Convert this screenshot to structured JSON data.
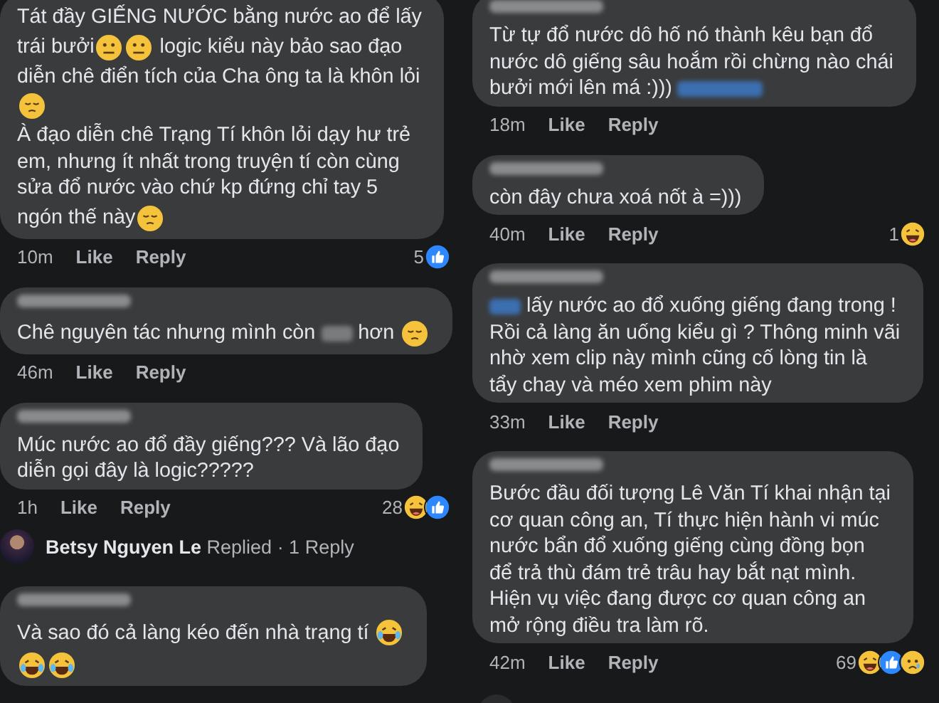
{
  "columns": [
    {
      "items": [
        {
          "kind": "comment",
          "name_visible": false,
          "lines": [
            [
              {
                "kind": "text",
                "text": "Tát đầy GIẾNG NƯỚC bằng nước ao để lấy"
              }
            ],
            [
              {
                "kind": "text",
                "text": "trái bưởi"
              },
              {
                "kind": "emoji-neutral"
              },
              {
                "kind": "emoji-neutral"
              },
              {
                "kind": "text",
                "text": " logic kiểu này bảo sao đạo"
              }
            ],
            [
              {
                "kind": "text",
                "text": "diễn chê điển tích của Cha ông ta là khôn lỏi"
              }
            ],
            [
              {
                "kind": "emoji-pensive"
              }
            ],
            [
              {
                "kind": "text",
                "text": "À đạo diễn chê Trạng Tí khôn lỏi dạy hư trẻ"
              }
            ],
            [
              {
                "kind": "text",
                "text": "em, nhưng ít nhất trong truyện tí còn cùng"
              }
            ],
            [
              {
                "kind": "text",
                "text": "sửa đổ nước vào chứ kp đứng chỉ tay 5"
              }
            ],
            [
              {
                "kind": "text",
                "text": "ngón thế này"
              },
              {
                "kind": "emoji-pensive"
              }
            ]
          ],
          "time": "10m",
          "like": "Like",
          "reply": "Reply",
          "reaction_count": "5",
          "reactions": [
            {
              "kind": "like"
            }
          ]
        },
        {
          "kind": "comment",
          "name_visible": true,
          "lines": [
            [
              {
                "kind": "text",
                "text": "Chê nguyên tác nhưng mình còn "
              },
              {
                "kind": "blur"
              },
              {
                "kind": "text",
                "text": " hơn "
              },
              {
                "kind": "emoji-pensive"
              }
            ]
          ],
          "time": "46m",
          "like": "Like",
          "reply": "Reply"
        },
        {
          "kind": "comment",
          "name_visible": true,
          "lines": [
            [
              {
                "kind": "text",
                "text": "Múc nước ao đổ đầy giếng??? Và lão đạo"
              }
            ],
            [
              {
                "kind": "text",
                "text": "diễn gọi đây là logic?????"
              }
            ]
          ],
          "time": "1h",
          "like": "Like",
          "reply": "Reply",
          "reaction_count": "28",
          "reactions": [
            {
              "kind": "haha"
            },
            {
              "kind": "like"
            }
          ]
        },
        {
          "kind": "replies",
          "text": "**Betsy Nguyen Le** Replied · 1 Reply"
        },
        {
          "kind": "comment",
          "name_visible": true,
          "lines": [
            [
              {
                "kind": "text",
                "text": "Và sao đó cả làng kéo đến nhà trạng tí "
              },
              {
                "kind": "emoji-joy"
              }
            ],
            [
              {
                "kind": "emoji-joy"
              },
              {
                "kind": "emoji-joy"
              }
            ]
          ]
        }
      ]
    },
    {
      "items": [
        {
          "kind": "comment",
          "name_visible": true,
          "lines": [
            [
              {
                "kind": "text",
                "text": "Từ tự đổ nước dô hố nó thành kêu bạn đổ"
              }
            ],
            [
              {
                "kind": "text",
                "text": "nước dô giếng sâu hoắm rồi chừng nào chái"
              }
            ],
            [
              {
                "kind": "text",
                "text": "bưởi mới lên má :))) "
              },
              {
                "kind": "mention-blur"
              }
            ]
          ],
          "time": "18m",
          "like": "Like",
          "reply": "Reply"
        },
        {
          "kind": "comment",
          "name_visible": true,
          "lines": [
            [
              {
                "kind": "text",
                "text": "còn đây chưa xoá nốt à =)))"
              }
            ]
          ],
          "time": "40m",
          "like": "Like",
          "reply": "Reply",
          "reaction_count": "1",
          "reactions": [
            {
              "kind": "haha"
            }
          ]
        },
        {
          "kind": "comment",
          "name_visible": true,
          "lines": [
            [
              {
                "kind": "blur-link"
              },
              {
                "kind": "text",
                "text": " lấy nước ao đổ xuống giếng đang trong !"
              }
            ],
            [
              {
                "kind": "text",
                "text": "Rồi cả làng ăn uống kiểu gì ? Thông minh vãi"
              }
            ],
            [
              {
                "kind": "text",
                "text": "nhờ xem clip này mình cũng cố lòng tin là"
              }
            ],
            [
              {
                "kind": "text",
                "text": "tẩy chay và méo xem phim này"
              }
            ]
          ],
          "time": "33m",
          "like": "Like",
          "reply": "Reply"
        },
        {
          "kind": "comment",
          "name_visible": true,
          "lines": [
            [
              {
                "kind": "text",
                "text": "Bước đầu đối tượng Lê Văn Tí khai nhận tại"
              }
            ],
            [
              {
                "kind": "text",
                "text": "cơ quan công an, Tí thực hiện hành vi múc"
              }
            ],
            [
              {
                "kind": "text",
                "text": "nước bẩn đổ xuống giếng cùng đồng bọn"
              }
            ],
            [
              {
                "kind": "text",
                "text": "để trả thù đám trẻ trâu hay bắt nạt mình."
              }
            ],
            [
              {
                "kind": "text",
                "text": "Hiện vụ việc đang được cơ quan công an"
              }
            ],
            [
              {
                "kind": "text",
                "text": "mở rộng điều tra làm rõ."
              }
            ]
          ],
          "time": "42m",
          "like": "Like",
          "reply": "Reply",
          "reaction_count": "69",
          "reactions": [
            {
              "kind": "haha"
            },
            {
              "kind": "like"
            },
            {
              "kind": "sad"
            }
          ]
        },
        {
          "kind": "avatar"
        }
      ]
    }
  ]
}
